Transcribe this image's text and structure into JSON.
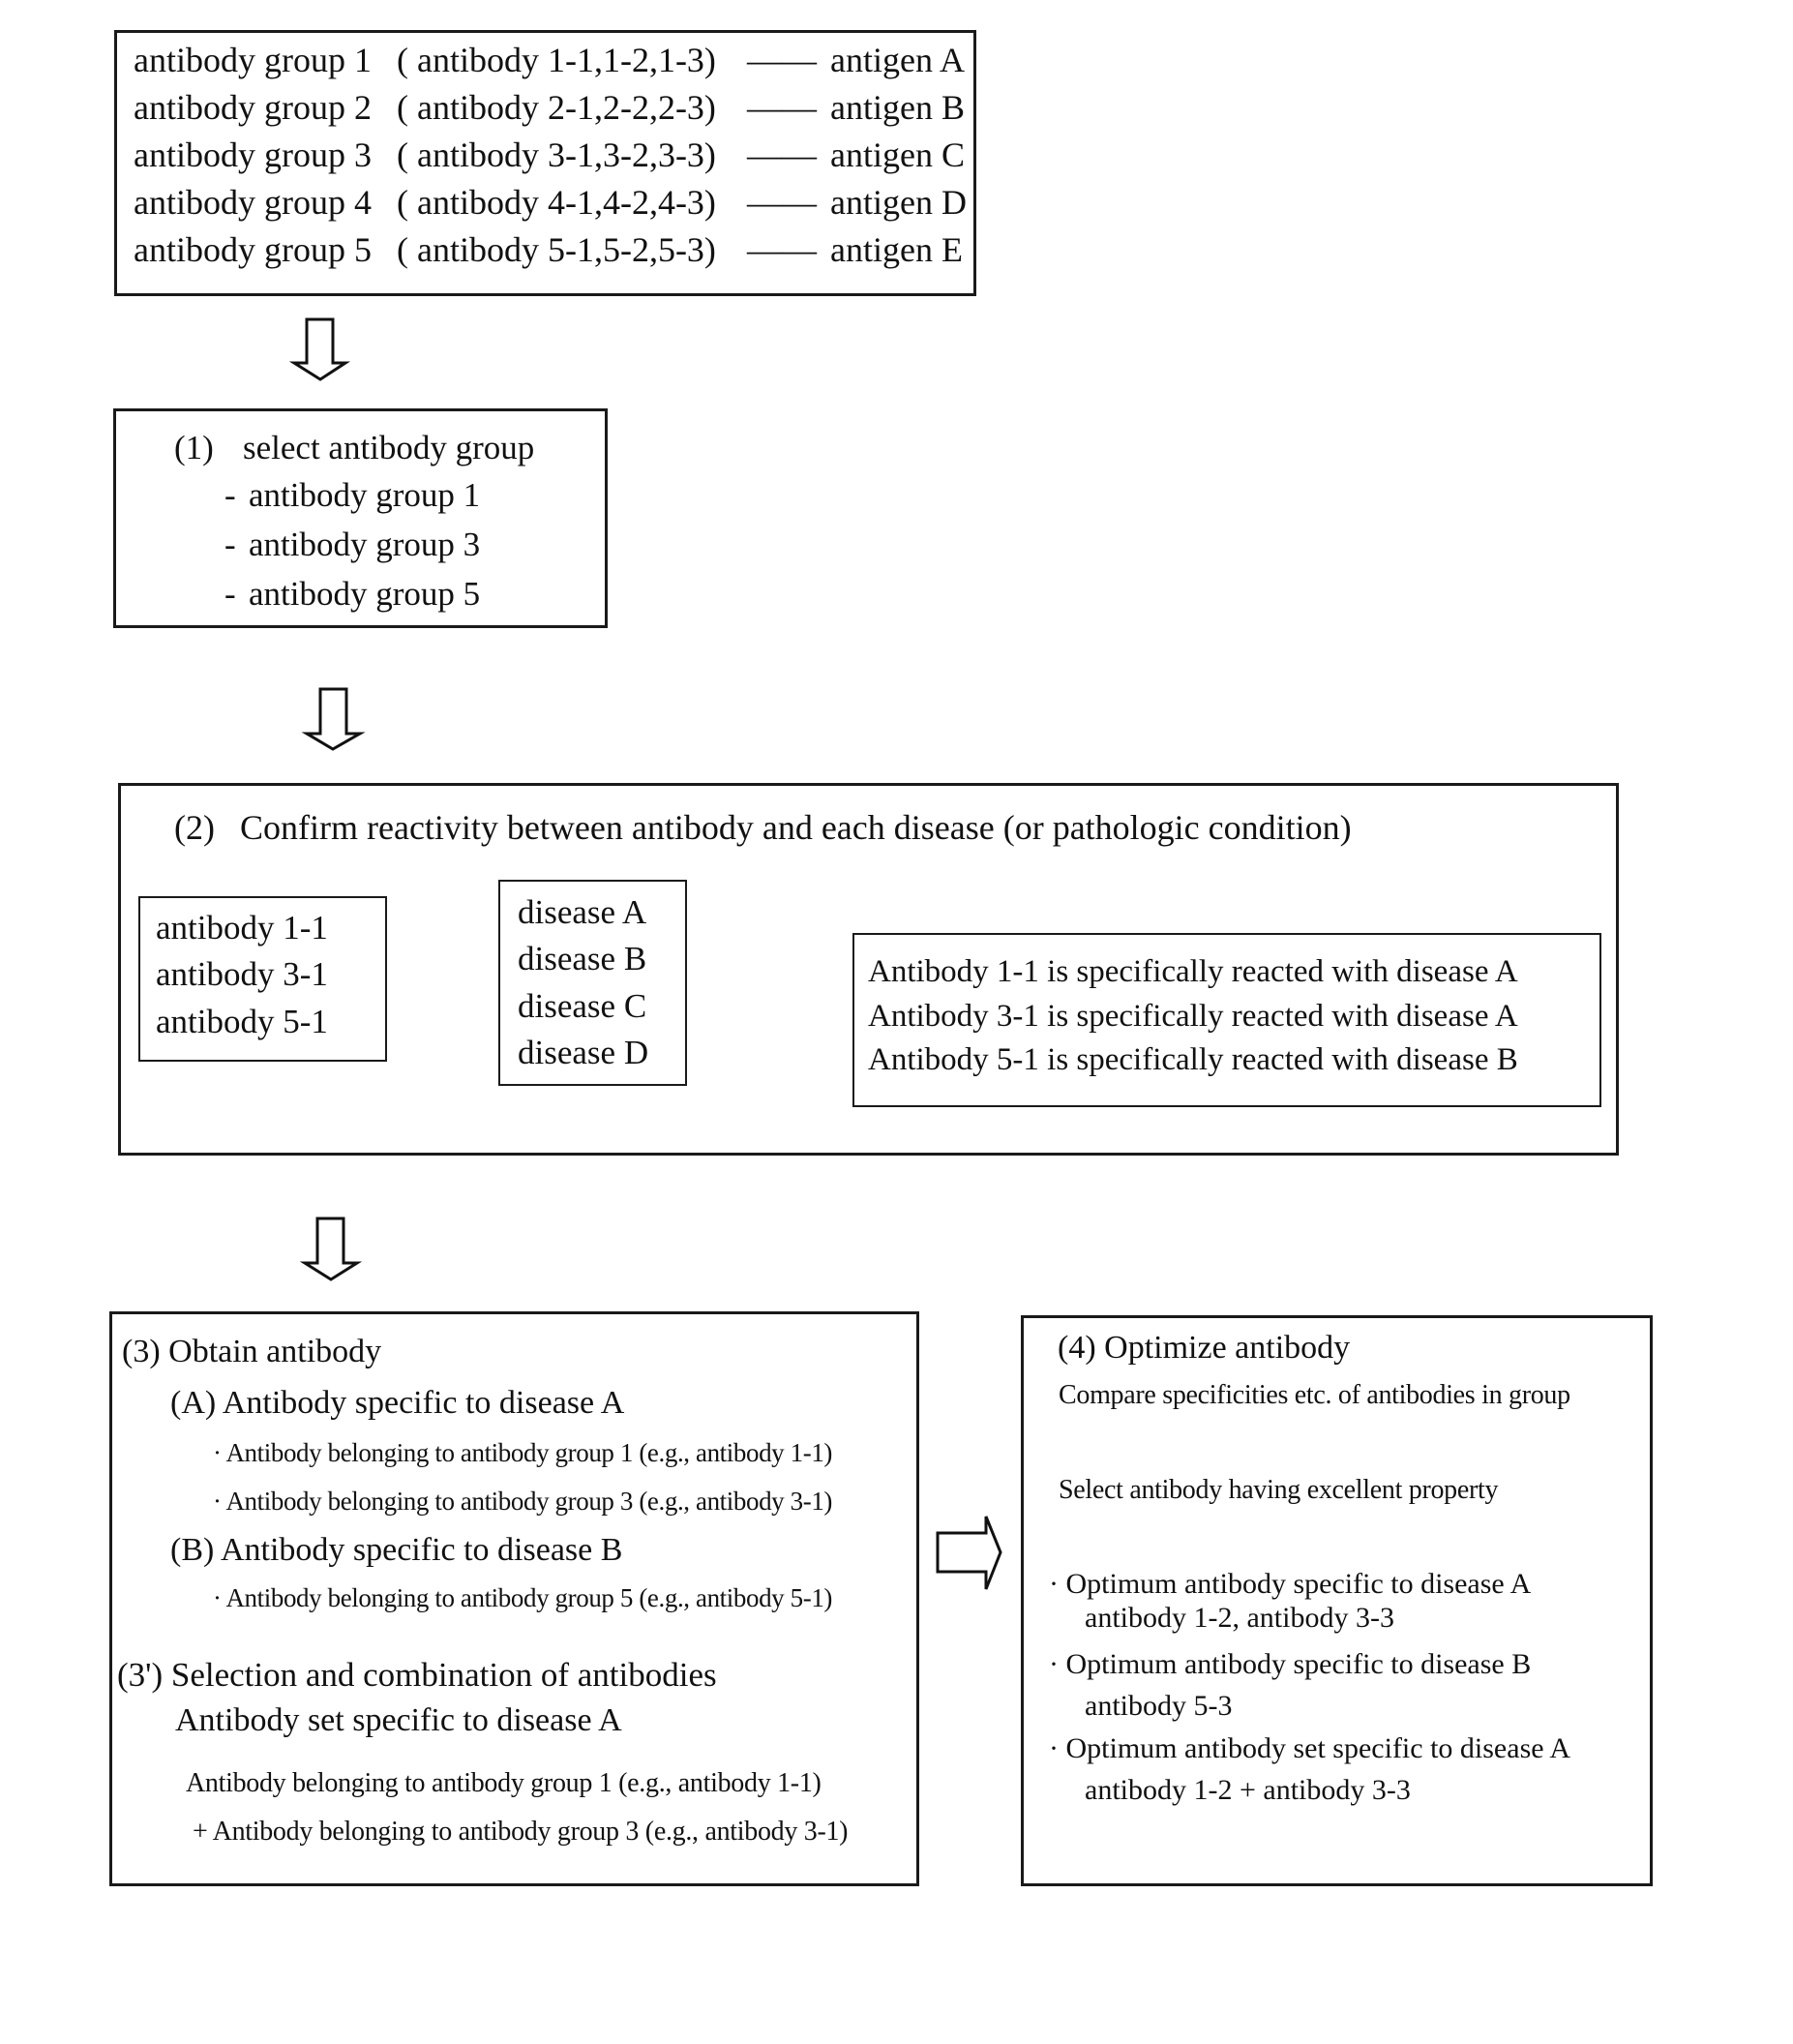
{
  "antibody_groups_box": {
    "rows": [
      {
        "group": "antibody group 1",
        "members": "( antibody 1-1,1-2,1-3)",
        "connector": "——",
        "antigen": "antigen A"
      },
      {
        "group": "antibody group 2",
        "members": "( antibody 2-1,2-2,2-3)",
        "connector": "——",
        "antigen": "antigen B"
      },
      {
        "group": "antibody group 3",
        "members": "( antibody 3-1,3-2,3-3)",
        "connector": "——",
        "antigen": "antigen C"
      },
      {
        "group": "antibody group 4",
        "members": "( antibody 4-1,4-2,4-3)",
        "connector": "——",
        "antigen": "antigen D"
      },
      {
        "group": "antibody group 5",
        "members": "( antibody 5-1,5-2,5-3)",
        "connector": "——",
        "antigen": "antigen E"
      }
    ]
  },
  "step1": {
    "number": "(1)",
    "title": "select antibody group",
    "bullet": "-",
    "items": [
      "antibody group 1",
      "antibody group 3",
      "antibody group 5"
    ]
  },
  "step2": {
    "number": "(2)",
    "title": "Confirm reactivity between antibody and each disease (or pathologic condition)",
    "antibodies": [
      "antibody 1-1",
      "antibody 3-1",
      "antibody 5-1"
    ],
    "diseases": [
      "disease A",
      "disease B",
      "disease C",
      "disease D"
    ],
    "results": [
      "Antibody 1-1 is specifically reacted with disease A",
      "Antibody 3-1 is specifically reacted with disease A",
      "Antibody 5-1 is specifically reacted with disease B"
    ]
  },
  "step3": {
    "title": "(3) Obtain antibody",
    "sections": [
      {
        "heading": "(A) Antibody specific to disease A",
        "items": [
          "· Antibody belonging to antibody group 1 (e.g., antibody 1-1)",
          "· Antibody belonging to antibody group 3 (e.g., antibody 3-1)"
        ]
      },
      {
        "heading": "(B) Antibody specific to disease B",
        "items": [
          "· Antibody belonging to antibody group 5 (e.g., antibody 5-1)"
        ]
      }
    ],
    "combination_title": "(3') Selection and combination of antibodies",
    "combination_heading": "Antibody set specific to disease A",
    "combination_lines": [
      "Antibody belonging to antibody group 1 (e.g., antibody 1-1)",
      "+ Antibody belonging to antibody group 3 (e.g., antibody 3-1)"
    ]
  },
  "step4": {
    "title": "(4) Optimize antibody",
    "compare": "Compare specificities etc. of antibodies in group",
    "select": "Select antibody having excellent property",
    "results": [
      {
        "label": "· Optimum antibody specific to disease A",
        "value": "antibody 1-2, antibody 3-3"
      },
      {
        "label": "· Optimum antibody specific to disease B",
        "value": "antibody 5-3"
      },
      {
        "label": "· Optimum antibody set specific to disease A",
        "value": "antibody 1-2 + antibody 3-3"
      }
    ]
  },
  "icons": {
    "flow_down_arrow": "down-block-arrow",
    "flow_right_arrow": "right-block-arrow",
    "cross": "x-multiply",
    "small_down_arrow": "down-arrow"
  }
}
